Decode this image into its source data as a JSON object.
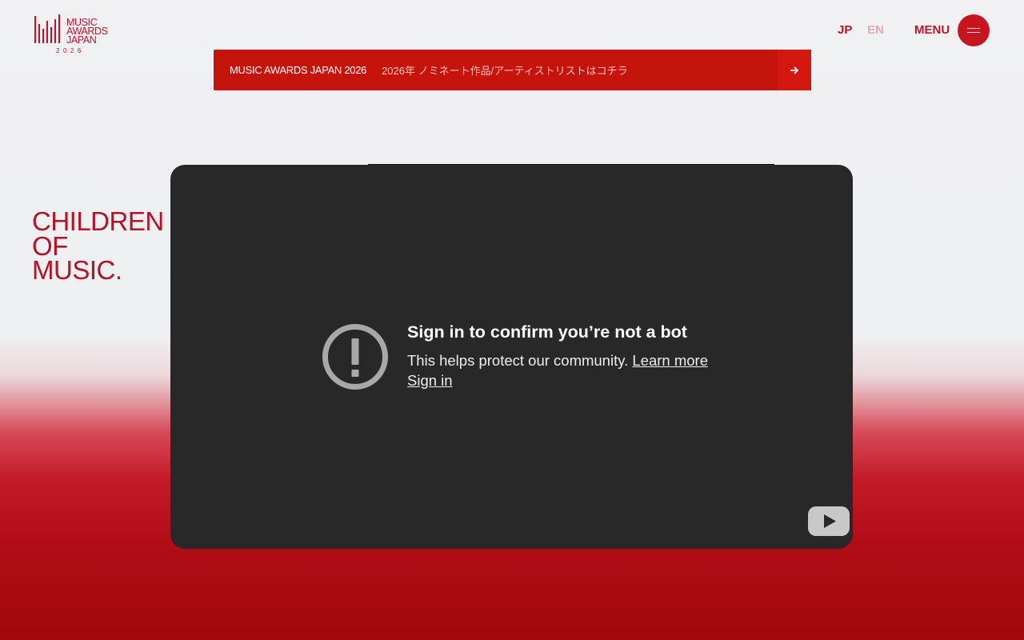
{
  "header": {
    "logo": {
      "line1": "MUSIC",
      "line2": "AWARDS",
      "line3": "JAPAN",
      "year": "2026"
    },
    "lang_jp": "JP",
    "lang_en": "EN",
    "menu_label": "MENU"
  },
  "banner": {
    "title": "MUSIC AWARDS JAPAN 2026",
    "text": "2026年 ノミネート作品/アーティストリストはコチラ"
  },
  "hero": {
    "tagline": [
      "CHILDREN",
      "OF",
      "MUSIC."
    ]
  },
  "video": {
    "title": "Sign in to confirm you’re not a bot",
    "message": "This helps protect our community.",
    "learn_more": "Learn more",
    "sign_in": "Sign in"
  },
  "colors": {
    "brand_red": "#c4140c",
    "text_red": "#b21426",
    "player_bg": "#282828"
  },
  "icons": {
    "menu": "hamburger-icon",
    "banner_arrow": "arrow-right-icon",
    "warning": "exclamation-circle-icon",
    "youtube": "youtube-play-icon"
  }
}
